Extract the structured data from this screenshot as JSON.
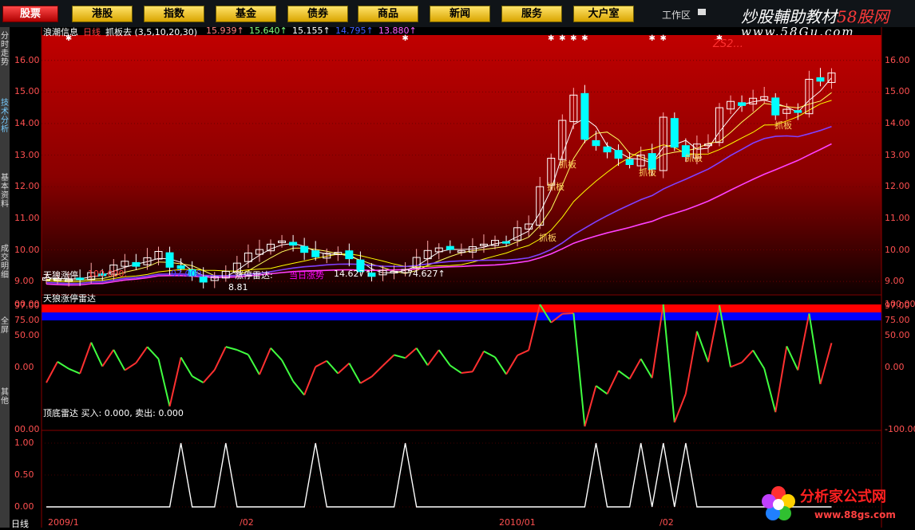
{
  "nav": {
    "tabs": [
      "股票",
      "港股",
      "指数",
      "基金",
      "债券",
      "商品",
      "新闻",
      "服务",
      "大户室"
    ],
    "active": 0,
    "work_area": "工作区"
  },
  "branding": {
    "top_text": "炒股輔助教材",
    "top_red": "58股网",
    "top_url": "www.58Gu.com",
    "bottom_text": "分析家公式网",
    "bottom_url": "www.88gs.com",
    "watermark": "ZS2..."
  },
  "left_tabs": [
    "分时走势",
    "技术分析",
    "基本资料",
    "成交明细",
    "全屏",
    "其他"
  ],
  "main": {
    "title": "浪潮信息",
    "period": "日线",
    "indicator": "抓板去 (3,5,10,20,30)",
    "ma_values": [
      "15.939↑",
      "15.640↑",
      "15.155↑",
      "14.795↑",
      "13.880↑"
    ],
    "y_labels": [
      "16.00",
      "15.00",
      "14.00",
      "13.00",
      "12.00",
      "11.00",
      "10.00",
      "9.00"
    ],
    "low_label": "8.81",
    "signal_label": "抓板"
  },
  "panel2": {
    "header": [
      "天狼涨停",
      "100.000,",
      "97.000",
      "涨停雷达:",
      "当日涨势",
      "14.627↑",
      "74.627↑"
    ],
    "sub": "天狼涨停雷达",
    "y_left": [
      "00.00",
      "97.00",
      "75.00",
      "50.00",
      "0.00",
      "00.00"
    ],
    "y_right": [
      "100.00",
      "97.00",
      "75.00",
      "50.00",
      "0.00",
      "-100.00"
    ]
  },
  "panel3": {
    "header": "顶底雷达  买入: 0.000, 卖出: 0.000",
    "y_labels": [
      "1.00",
      "0.50",
      "0.00"
    ]
  },
  "footer": {
    "period": "日线",
    "dates": [
      "2009/1",
      "/02",
      "2010/01",
      "/02"
    ],
    "right": "日线"
  },
  "colors": {
    "up": "#ff4040",
    "down": "#00ffff",
    "ma1": "#ffffff",
    "ma2": "#ffff60",
    "ma3": "#ffff00",
    "ma4": "#8040ff",
    "ma5": "#ff40ff"
  },
  "chart_data": {
    "type": "candlestick",
    "closes": [
      9.12,
      9.08,
      9.06,
      9.1,
      9.28,
      9.18,
      9.52,
      9.64,
      9.48,
      9.75,
      9.95,
      9.45,
      9.41,
      9.18,
      8.98,
      9.15,
      9.32,
      9.58,
      9.9,
      10.01,
      10.18,
      10.28,
      10.15,
      9.92,
      9.78,
      9.89,
      9.92,
      9.72,
      9.31,
      9.16,
      9.35,
      9.32,
      9.38,
      9.76,
      9.98,
      10.06,
      10.01,
      9.97,
      10.1,
      10.18,
      10.3,
      10.26,
      10.7,
      10.82,
      12.0,
      12.9,
      14.1,
      14.9,
      13.5,
      13.3,
      13.1,
      12.9,
      12.7,
      13.0,
      12.55,
      14.2,
      13.25,
      12.95,
      13.35,
      13.35,
      14.5,
      14.7,
      14.57,
      14.8,
      14.85,
      14.27,
      14.45,
      14.35,
      15.4,
      15.34,
      15.6
    ],
    "bottom_signals": [
      12,
      16,
      24,
      32,
      49,
      53,
      55,
      57
    ]
  }
}
